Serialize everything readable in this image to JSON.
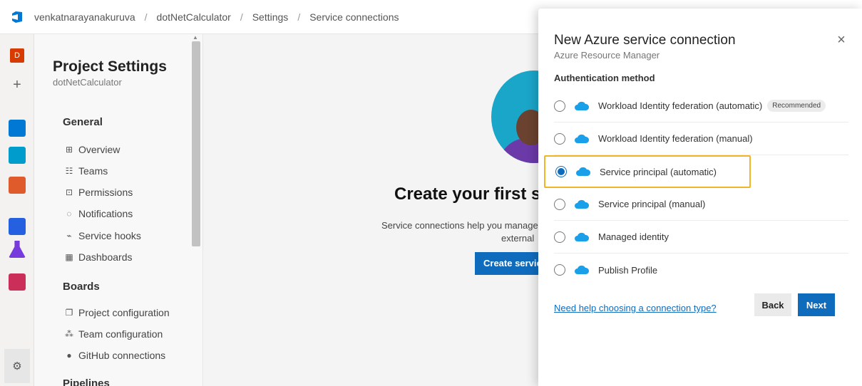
{
  "breadcrumb": {
    "org": "venkatnarayanakuruva",
    "project": "dotNetCalculator",
    "settings": "Settings",
    "page": "Service connections",
    "separator": "/"
  },
  "rail": {
    "project_initial": "D",
    "plus": "+",
    "colors": {
      "project": "#d83b01",
      "overview": "#0078d4",
      "boards": "#009ccc",
      "repos": "#e05b2b",
      "pipelines": "#2560e0",
      "test": "#773adc",
      "artifacts": "#cc2e5a"
    }
  },
  "sidebar": {
    "title": "Project Settings",
    "subtitle": "dotNetCalculator",
    "general_heading": "General",
    "general_items": [
      {
        "icon": "⊞",
        "label": "Overview"
      },
      {
        "icon": "☷",
        "label": "Teams"
      },
      {
        "icon": "⊡",
        "label": "Permissions"
      },
      {
        "icon": "◌",
        "label": "Notifications"
      },
      {
        "icon": "⌁",
        "label": "Service hooks"
      },
      {
        "icon": "▦",
        "label": "Dashboards"
      }
    ],
    "boards_heading": "Boards",
    "boards_items": [
      {
        "icon": "❐",
        "label": "Project configuration"
      },
      {
        "icon": "⁂",
        "label": "Team configuration"
      },
      {
        "icon": "●",
        "label": "GitHub connections"
      }
    ],
    "pipelines_heading": "Pipelines"
  },
  "main": {
    "title": "Create your first s",
    "text_line1": "Service connections help you manage",
    "text_line2": "external",
    "button": "Create servic"
  },
  "panel": {
    "title": "New Azure service connection",
    "subtitle": "Azure Resource Manager",
    "close": "×",
    "auth_label": "Authentication method",
    "options": [
      {
        "label": "Workload Identity federation (automatic)",
        "badge": "Recommended",
        "checked": false
      },
      {
        "label": "Workload Identity federation (manual)",
        "checked": false
      },
      {
        "label": "Service principal (automatic)",
        "checked": true
      },
      {
        "label": "Service principal (manual)",
        "checked": false
      },
      {
        "label": "Managed identity",
        "checked": false
      },
      {
        "label": "Publish Profile",
        "checked": false
      }
    ],
    "help_link": "Need help choosing a connection type?",
    "back_label": "Back",
    "next_label": "Next",
    "accent_color": "#0f6cbd",
    "highlight_color": "#f0b429",
    "cloud_color": "#1aa0e8"
  }
}
